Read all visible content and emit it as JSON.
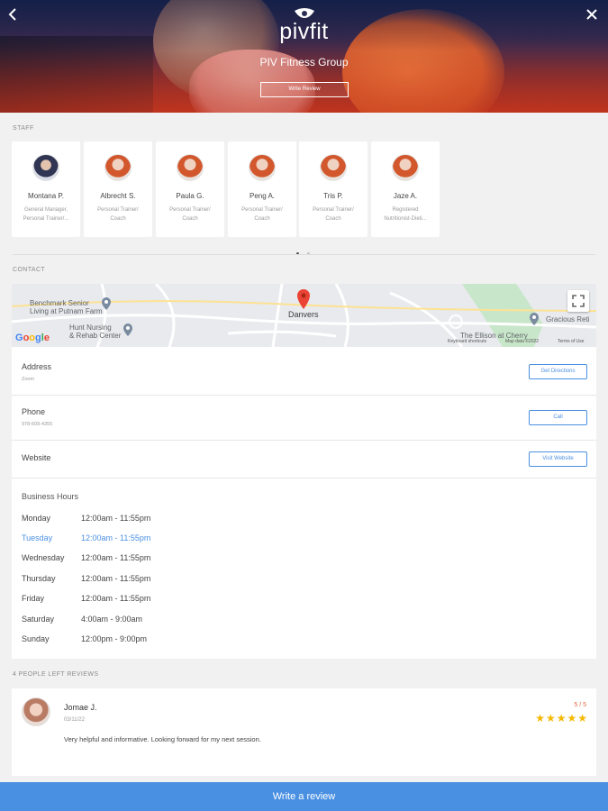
{
  "hero": {
    "logo_text": "pivfit",
    "gym_name": "PIV Fitness Group",
    "write_review_label": "Write Review"
  },
  "nav": {
    "back_icon": "chevron-left-icon",
    "close_icon": "close-icon"
  },
  "staff": {
    "section_label": "STAFF",
    "members": [
      {
        "name": "Montana P.",
        "role_line1": "General Manager,",
        "role_line2": "Personal Trainer/..."
      },
      {
        "name": "Albrecht S.",
        "role_line1": "Personal Trainer/",
        "role_line2": "Coach"
      },
      {
        "name": "Paula G.",
        "role_line1": "Personal Trainer/",
        "role_line2": "Coach"
      },
      {
        "name": "Peng A.",
        "role_line1": "Personal Trainer/",
        "role_line2": "Coach"
      },
      {
        "name": "Tris P.",
        "role_line1": "Personal Trainer/",
        "role_line2": "Coach"
      },
      {
        "name": "Jaze A.",
        "role_line1": "Registered",
        "role_line2": "Nutritionist-Dieti..."
      }
    ],
    "pager": {
      "pages": 2,
      "current": 1
    }
  },
  "contact": {
    "section_label": "CONTACT",
    "map": {
      "town": "Danvers",
      "place1": "Benchmark Senior",
      "place1b": "Living at Putnam Farm",
      "place2": "Hunt Nursing",
      "place2b": "& Rehab Center",
      "place3": "The Ellison at Cherry",
      "place4": "Gracious Reti",
      "footer_shortcuts": "Keyboard shortcuts",
      "footer_data": "Map data ©2022",
      "footer_terms": "Terms of Use",
      "google_letters": [
        "G",
        "o",
        "o",
        "g",
        "l",
        "e"
      ]
    },
    "address_label": "Address",
    "address_value": "Zoom",
    "address_button": "Get Directions",
    "phone_label": "Phone",
    "phone_value": "978-609-4355",
    "phone_button": "Call",
    "website_label": "Website",
    "website_button": "Visit Website",
    "hours_title": "Business Hours",
    "hours": [
      {
        "day": "Monday",
        "time": "12:00am - 11:55pm"
      },
      {
        "day": "Tuesday",
        "time": "12:00am - 11:55pm"
      },
      {
        "day": "Wednesday",
        "time": "12:00am - 11:55pm"
      },
      {
        "day": "Thursday",
        "time": "12:00am - 11:55pm"
      },
      {
        "day": "Friday",
        "time": "12:00am - 11:55pm"
      },
      {
        "day": "Saturday",
        "time": "4:00am - 9:00am"
      },
      {
        "day": "Sunday",
        "time": "12:00pm - 9:00pm"
      }
    ],
    "today": "Tuesday"
  },
  "reviews": {
    "section_label": "4 PEOPLE LEFT REVIEWS",
    "items": [
      {
        "name": "Jomae J.",
        "date": "03/11/22",
        "score": "5 / 5",
        "stars": "★★★★★",
        "rating": 5,
        "text": "Very helpful and informative. Looking forward for my next session."
      }
    ]
  },
  "bottom_bar": {
    "label": "Write a review"
  },
  "colors": {
    "accent": "#4a90e2",
    "star": "#f5b800",
    "score": "#e0673b"
  }
}
